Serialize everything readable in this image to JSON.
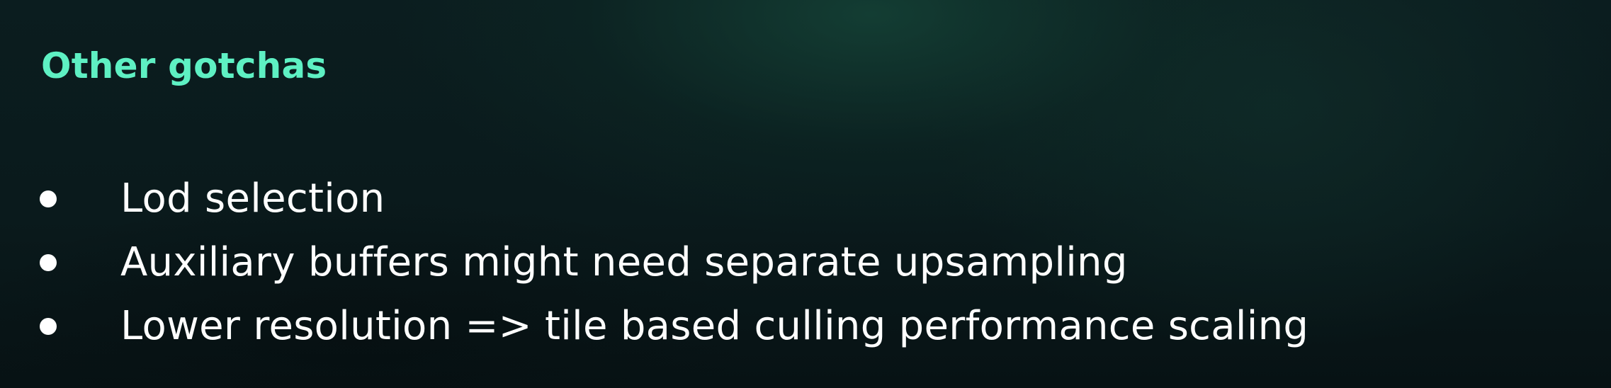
{
  "slide": {
    "title": "Other gotchas",
    "bullets": [
      "Lod selection",
      "Auxiliary buffers might need separate upsampling",
      "Lower resolution => tile based culling performance scaling"
    ]
  },
  "colors": {
    "title": "#5ef0c3",
    "text": "#ffffff",
    "background": "#0a1a1c",
    "glow": "#16483a"
  }
}
